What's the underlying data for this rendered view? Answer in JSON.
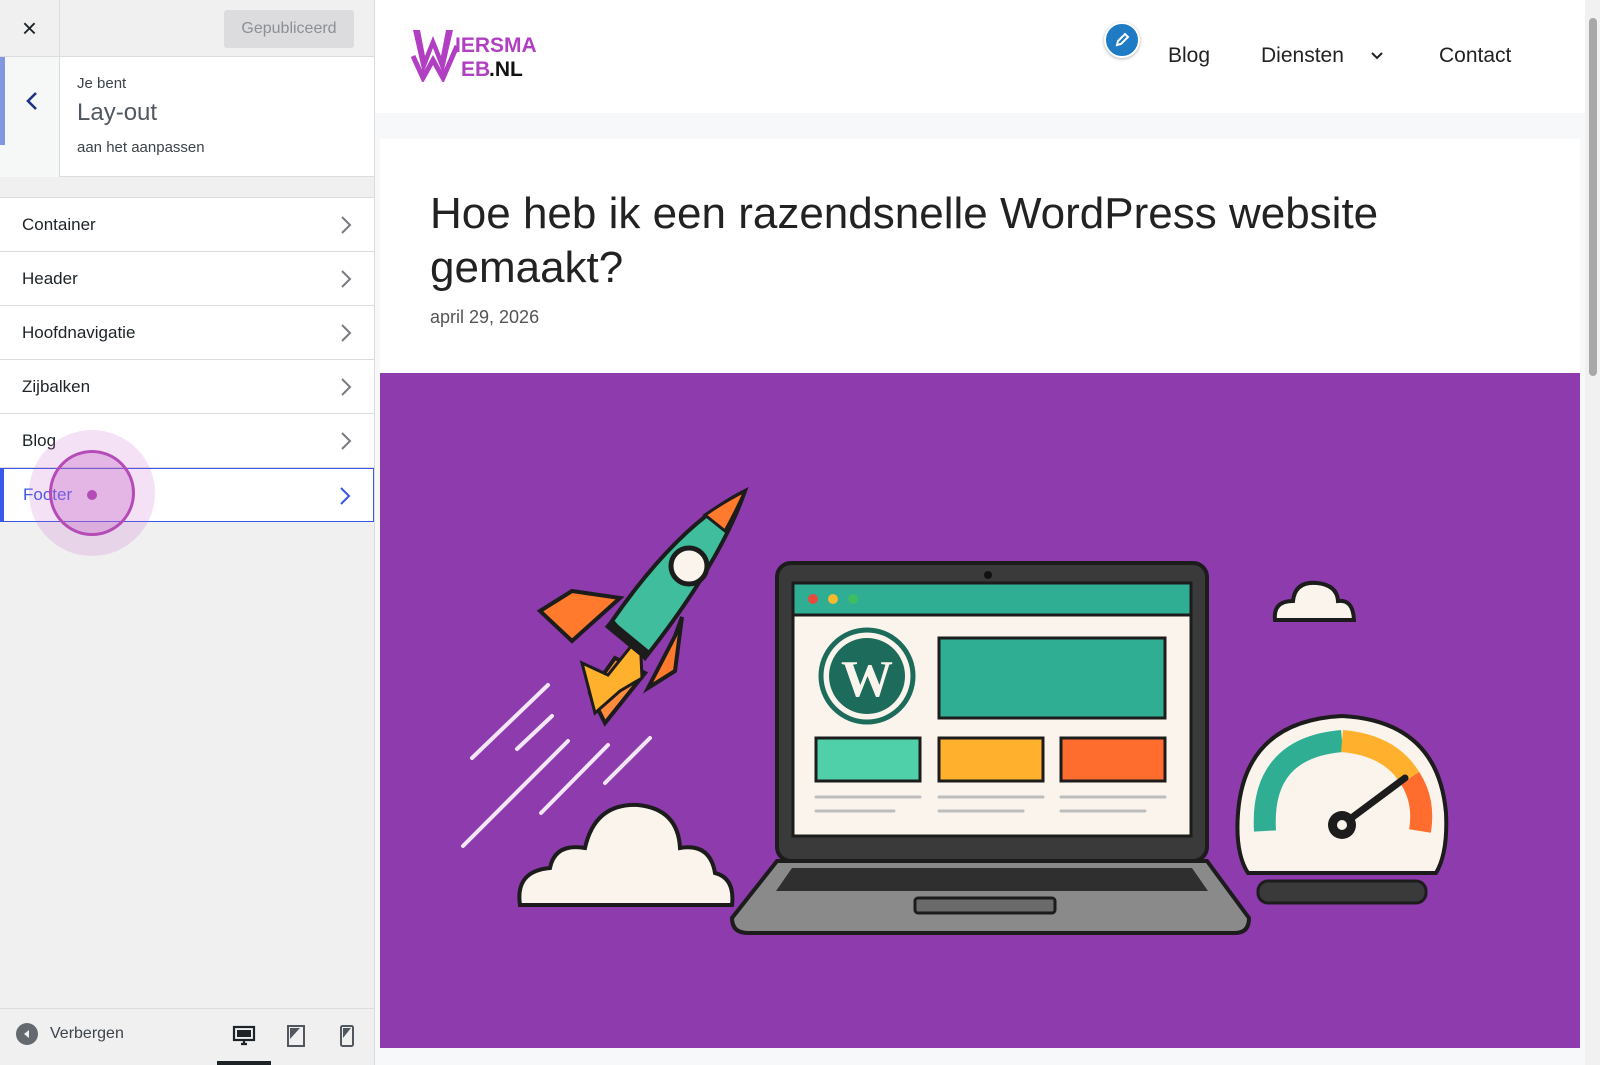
{
  "customizer": {
    "close_label": "×",
    "publish_label": "Gepubliceerd",
    "section": {
      "pre_label": "Je bent",
      "title": "Lay-out",
      "post_label": "aan het aanpassen"
    },
    "menu_items": [
      {
        "label": "Container"
      },
      {
        "label": "Header"
      },
      {
        "label": "Hoofdnavigatie"
      },
      {
        "label": "Zijbalken"
      },
      {
        "label": "Blog"
      },
      {
        "label": "Footer"
      }
    ],
    "active_item": "Footer",
    "hide_label": "Verbergen",
    "devices": [
      "desktop",
      "tablet",
      "mobile"
    ],
    "active_device": "desktop"
  },
  "preview": {
    "logo_text_top": "IERSMA",
    "logo_text_bottom_eb": "EB",
    "logo_text_bottom_nl": ".NL",
    "nav": {
      "blog": "Blog",
      "diensten": "Diensten",
      "contact": "Contact"
    },
    "article": {
      "title": "Hoe heb ik een razendsnelle WordPress website gemaakt?",
      "date": "april 29, 2026"
    }
  },
  "colors": {
    "accent": "#3858e9",
    "hero_bg": "#8e3bad",
    "logo_purple": "#b13fc1",
    "edit_blue": "#1e7bc4"
  }
}
